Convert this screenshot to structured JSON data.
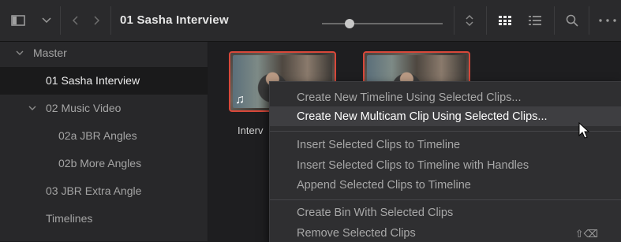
{
  "toolbar": {
    "title": "01 Sasha Interview",
    "icons": [
      "panel-toggle-icon",
      "chevron-down-icon",
      "back-icon",
      "forward-icon",
      "sort-icon",
      "grid-view-icon",
      "list-view-icon",
      "search-icon",
      "more-icon"
    ]
  },
  "sidebar": {
    "items": [
      {
        "label": "Master",
        "expanded": true
      },
      {
        "label": "01 Sasha Interview",
        "selected": true
      },
      {
        "label": "02 Music Video",
        "expanded": true
      },
      {
        "label": "02a JBR Angles"
      },
      {
        "label": "02b More Angles"
      },
      {
        "label": "03 JBR Extra Angle"
      },
      {
        "label": "Timelines"
      }
    ]
  },
  "clips": [
    {
      "label": "Interv",
      "has_audio_icon": true
    },
    {
      "label": ""
    }
  ],
  "context_menu": {
    "items": [
      {
        "label": "Create New Timeline Using Selected Clips..."
      },
      {
        "label": "Create New Multicam Clip Using Selected Clips...",
        "highlighted": true
      },
      {
        "label": "Insert Selected Clips to Timeline"
      },
      {
        "label": "Insert Selected Clips to Timeline with Handles"
      },
      {
        "label": "Append Selected Clips to Timeline"
      },
      {
        "label": "Create Bin With Selected Clips"
      },
      {
        "label": "Remove Selected Clips",
        "shortcut": "⇧⌫"
      }
    ]
  },
  "colors": {
    "accent_border": "#d8483a",
    "background": "#1c1c1e"
  }
}
